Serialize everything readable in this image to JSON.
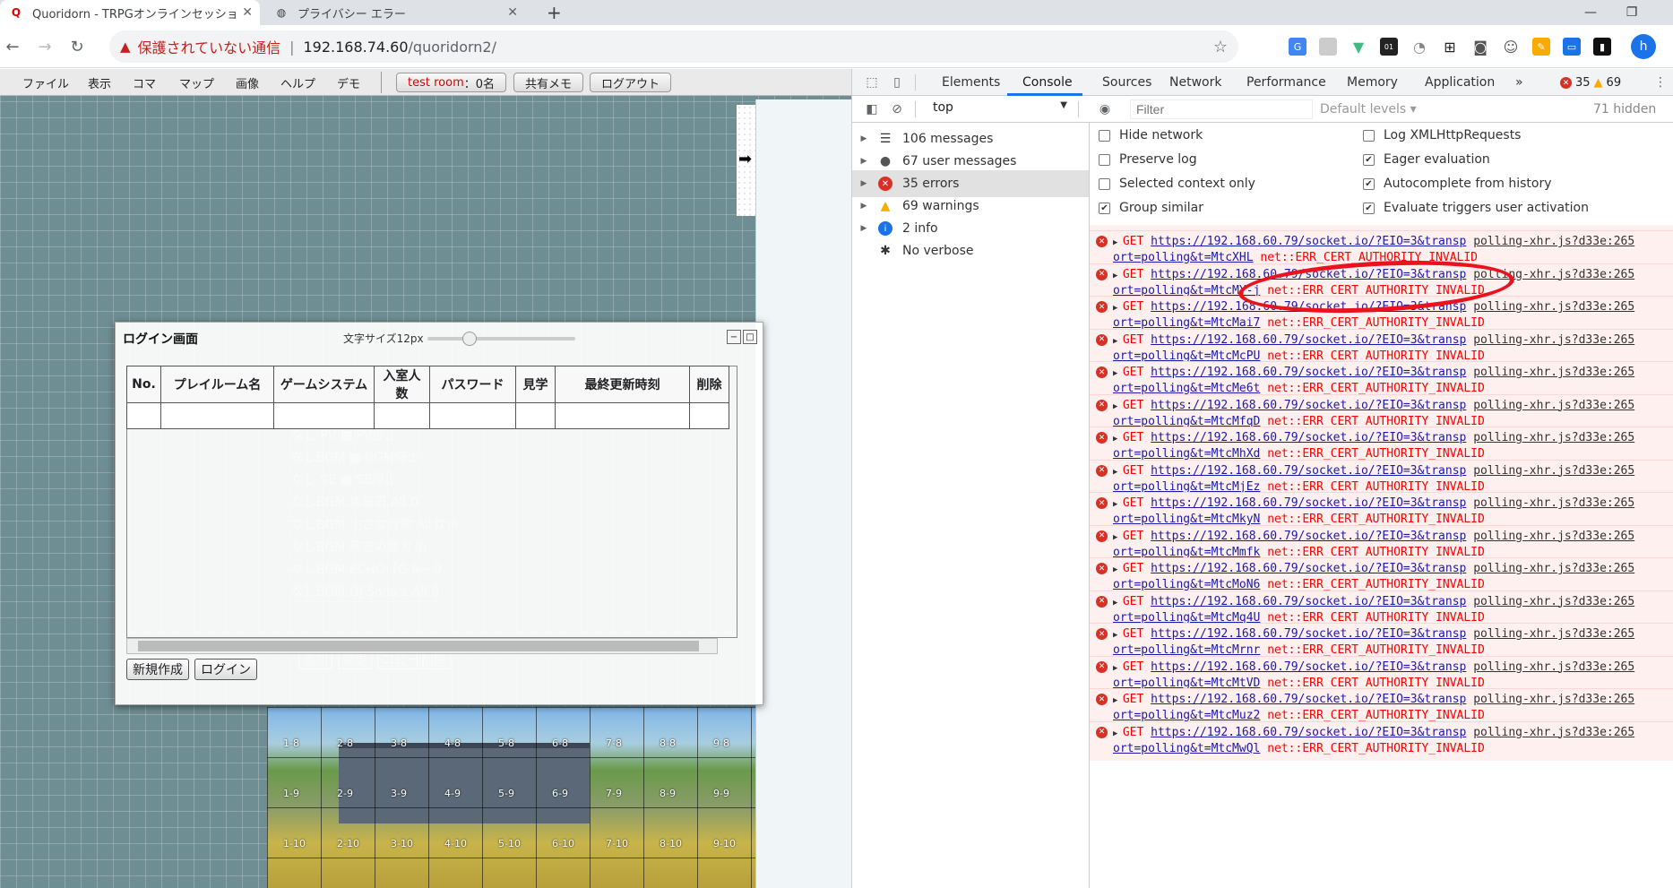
{
  "browser": {
    "tabs": [
      {
        "title": "Quoridorn - TRPGオンラインセッショ",
        "active": true
      },
      {
        "title": "プライバシー エラー",
        "active": false
      }
    ],
    "new_tab": "+",
    "omnibox": {
      "security": "保護されていない通信",
      "host": "192.168.74.60",
      "path": "/quoridorn2/"
    },
    "profile_initial": "h"
  },
  "quoridorn": {
    "menu": [
      "ファイル",
      "表示",
      "コマ",
      "マップ",
      "画像",
      "ヘルプ",
      "デモ"
    ],
    "room_label": "test room",
    "room_count": "：0名",
    "shared_memo": "共有メモ",
    "logout": "ログアウト",
    "login_dialog": {
      "title": "ログイン画面",
      "font_size_label": "文字サイズ12px",
      "columns": [
        "No.",
        "プレイルーム名",
        "ゲームシステム",
        "入室人数",
        "パスワード",
        "見学",
        "最終更新時刻",
        "削除"
      ],
      "new_button": "新規作成",
      "login_button": "ログイン"
    },
    "map_cells": [
      [
        "1-8",
        "2-8",
        "3-8",
        "4-8",
        "5-8",
        "6-8",
        "7-8",
        "8-8",
        "9-8"
      ],
      [
        "1-9",
        "2-9",
        "3-9",
        "4-9",
        "5-9",
        "6-9",
        "7-9",
        "8-9",
        "9-9"
      ],
      [
        "1-10",
        "2-10",
        "3-10",
        "4-10",
        "5-10",
        "6-10",
        "7-10",
        "8-10",
        "9-10"
      ]
    ],
    "bg_panel_rows": [
      "なし PV ■ PV停止",
      "なしBGM ■ BGM停止",
      "なし SE ■ SE停止",
      "なしBGM 馬車道 All 0",
      "なしBGM 小さな行進 All 0 in",
      "なしBGM 華志の舞 0 in",
      "なしBGM ECHO【G 8~ 0",
      "なしBGM DJ Sona's All 0"
    ],
    "bg_panel_buttons": [
      "追加",
      "変更",
      "コピー",
      "削除"
    ]
  },
  "devtools": {
    "tabs": [
      "Elements",
      "Console",
      "Sources",
      "Network",
      "Performance",
      "Memory",
      "Application"
    ],
    "active_tab": "Console",
    "more": "»",
    "error_count": "35",
    "warning_count": "69",
    "context": "top",
    "filter_placeholder": "Filter",
    "levels": "Default levels ▾",
    "hidden": "71 hidden",
    "sidebar": [
      {
        "label": "106 messages",
        "icon": "list-icon"
      },
      {
        "label": "67 user messages",
        "icon": "user-icon"
      },
      {
        "label": "35 errors",
        "icon": "error-icon"
      },
      {
        "label": "69 warnings",
        "icon": "warning-icon"
      },
      {
        "label": "2 info",
        "icon": "info-icon"
      },
      {
        "label": "No verbose",
        "icon": "bug-icon"
      }
    ],
    "settings_left": [
      {
        "label": "Hide network",
        "checked": false
      },
      {
        "label": "Preserve log",
        "checked": false
      },
      {
        "label": "Selected context only",
        "checked": false
      },
      {
        "label": "Group similar",
        "checked": true
      }
    ],
    "settings_right": [
      {
        "label": "Log XMLHttpRequests",
        "checked": false
      },
      {
        "label": "Eager evaluation",
        "checked": true
      },
      {
        "label": "Autocomplete from history",
        "checked": true
      },
      {
        "label": "Evaluate triggers user activation",
        "checked": true
      }
    ],
    "errors": [
      {
        "sid": "MtcXHL"
      },
      {
        "sid": "MtcMY-j"
      },
      {
        "sid": "MtcMai7"
      },
      {
        "sid": "MtcMcPU"
      },
      {
        "sid": "MtcMe6t"
      },
      {
        "sid": "MtcMfqD"
      },
      {
        "sid": "MtcMhXd"
      },
      {
        "sid": "MtcMjEz"
      },
      {
        "sid": "MtcMkyN"
      },
      {
        "sid": "MtcMmfk"
      },
      {
        "sid": "MtcMoN6"
      },
      {
        "sid": "MtcMq4U"
      },
      {
        "sid": "MtcMrnr"
      },
      {
        "sid": "MtcMtVD"
      },
      {
        "sid": "MtcMuz2"
      },
      {
        "sid": "MtcMwQl"
      }
    ],
    "error_text": {
      "method": "GET",
      "url": "https://192.168.60.79/socket.io/?EIO=3&transp",
      "url_cont": "ort=polling&t=",
      "source": "polling-xhr.js?d33e:265",
      "message": "net::ERR_CERT_AUTHORITY_INVALID"
    },
    "highlight_color": "#e8131f"
  }
}
